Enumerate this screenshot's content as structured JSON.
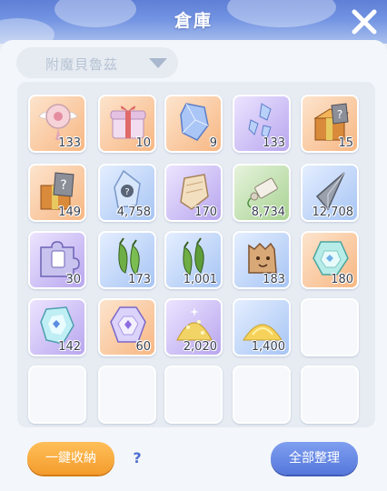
{
  "header": {
    "title": "倉庫"
  },
  "filter": {
    "selected": "附魔貝魯茲"
  },
  "items": [
    {
      "icon": "winged-orb-icon",
      "count": "133"
    },
    {
      "icon": "gift-box-icon",
      "count": "10"
    },
    {
      "icon": "blue-crystal-icon",
      "count": "9"
    },
    {
      "icon": "blue-crystal-shard-icon",
      "count": "133"
    },
    {
      "icon": "mystery-gift-icon",
      "count": "15"
    },
    {
      "icon": "mystery-gift-icon",
      "count": "149"
    },
    {
      "icon": "mystery-crystal-icon",
      "count": "4,758"
    },
    {
      "icon": "parchment-icon",
      "count": "170"
    },
    {
      "icon": "scroll-icon",
      "count": "8,734"
    },
    {
      "icon": "arrowhead-icon",
      "count": "12,708"
    },
    {
      "icon": "puzzle-card-icon",
      "count": "30"
    },
    {
      "icon": "pepper-icon",
      "count": "173"
    },
    {
      "icon": "pepper-icon",
      "count": "1,001"
    },
    {
      "icon": "bread-face-icon",
      "count": "183"
    },
    {
      "icon": "teal-gem-icon",
      "count": "180"
    },
    {
      "icon": "cyan-gem-icon",
      "count": "142"
    },
    {
      "icon": "violet-gem-icon",
      "count": "60"
    },
    {
      "icon": "gold-sparkle-pile-icon",
      "count": "2,020"
    },
    {
      "icon": "gold-sand-pile-icon",
      "count": "1,400"
    }
  ],
  "footer": {
    "store_all_label": "一鍵收納",
    "help_label": "?",
    "sort_all_label": "全部整理"
  },
  "colors": {
    "accent_orange": "#f5a53a",
    "accent_blue": "#5f80e0",
    "title_bar": "#6f8fe0"
  }
}
